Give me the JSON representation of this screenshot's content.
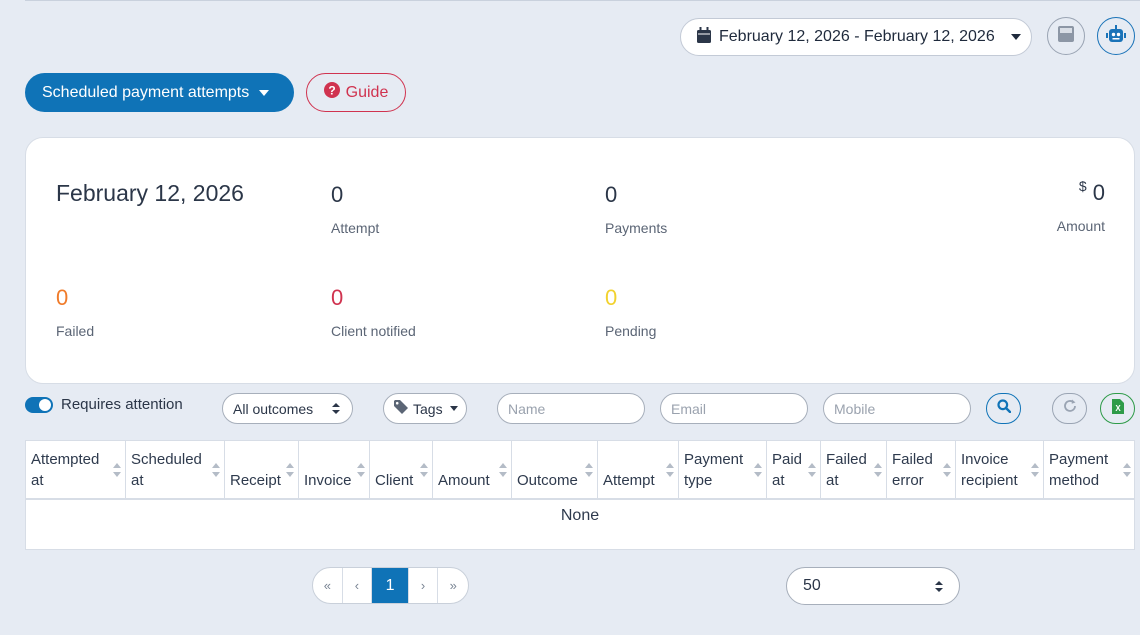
{
  "header": {
    "date_range": "February 12, 2026 - February 12, 2026"
  },
  "actions": {
    "report_select": "Scheduled payment attempts",
    "guide": "Guide"
  },
  "summary": {
    "date": "February 12, 2026",
    "attempt": {
      "value": "0",
      "label": "Attempt"
    },
    "payments": {
      "value": "0",
      "label": "Payments"
    },
    "amount": {
      "currency": "$",
      "value": "0",
      "label": "Amount"
    },
    "failed": {
      "value": "0",
      "label": "Failed",
      "color": "#f07b2a"
    },
    "client_notified": {
      "value": "0",
      "label": "Client notified",
      "color": "#d0334f"
    },
    "pending": {
      "value": "0",
      "label": "Pending",
      "color": "#f2d22e"
    }
  },
  "filters": {
    "requires_attention": "Requires attention",
    "outcomes": "All outcomes",
    "tags": "Tags",
    "name_placeholder": "Name",
    "email_placeholder": "Email",
    "mobile_placeholder": "Mobile"
  },
  "table": {
    "columns": [
      {
        "line1": "Attempted",
        "line2": "at"
      },
      {
        "line1": "Scheduled",
        "line2": "at"
      },
      {
        "line1": "",
        "line2": "Receipt"
      },
      {
        "line1": "",
        "line2": "Invoice"
      },
      {
        "line1": "",
        "line2": "Client"
      },
      {
        "line1": "",
        "line2": "Amount"
      },
      {
        "line1": "",
        "line2": "Outcome"
      },
      {
        "line1": "",
        "line2": "Attempt"
      },
      {
        "line1": "Payment",
        "line2": "type"
      },
      {
        "line1": "Paid",
        "line2": "at"
      },
      {
        "line1": "Failed",
        "line2": "at"
      },
      {
        "line1": "Failed",
        "line2": "error"
      },
      {
        "line1": "Invoice",
        "line2": "recipient"
      },
      {
        "line1": "Payment",
        "line2": "method"
      }
    ],
    "empty_text": "None"
  },
  "pagination": {
    "first": "«",
    "prev": "‹",
    "current": "1",
    "next": "›",
    "last": "»",
    "per_page": "50"
  },
  "colors": {
    "primary": "#0f73b7",
    "danger": "#d0334f",
    "excel": "#2e9b48",
    "background": "#e6ebf3"
  },
  "icons": [
    "calendar-icon",
    "calculator-icon",
    "robot-icon",
    "question-circle-icon",
    "tag-icon",
    "search-icon",
    "refresh-icon",
    "excel-icon"
  ]
}
